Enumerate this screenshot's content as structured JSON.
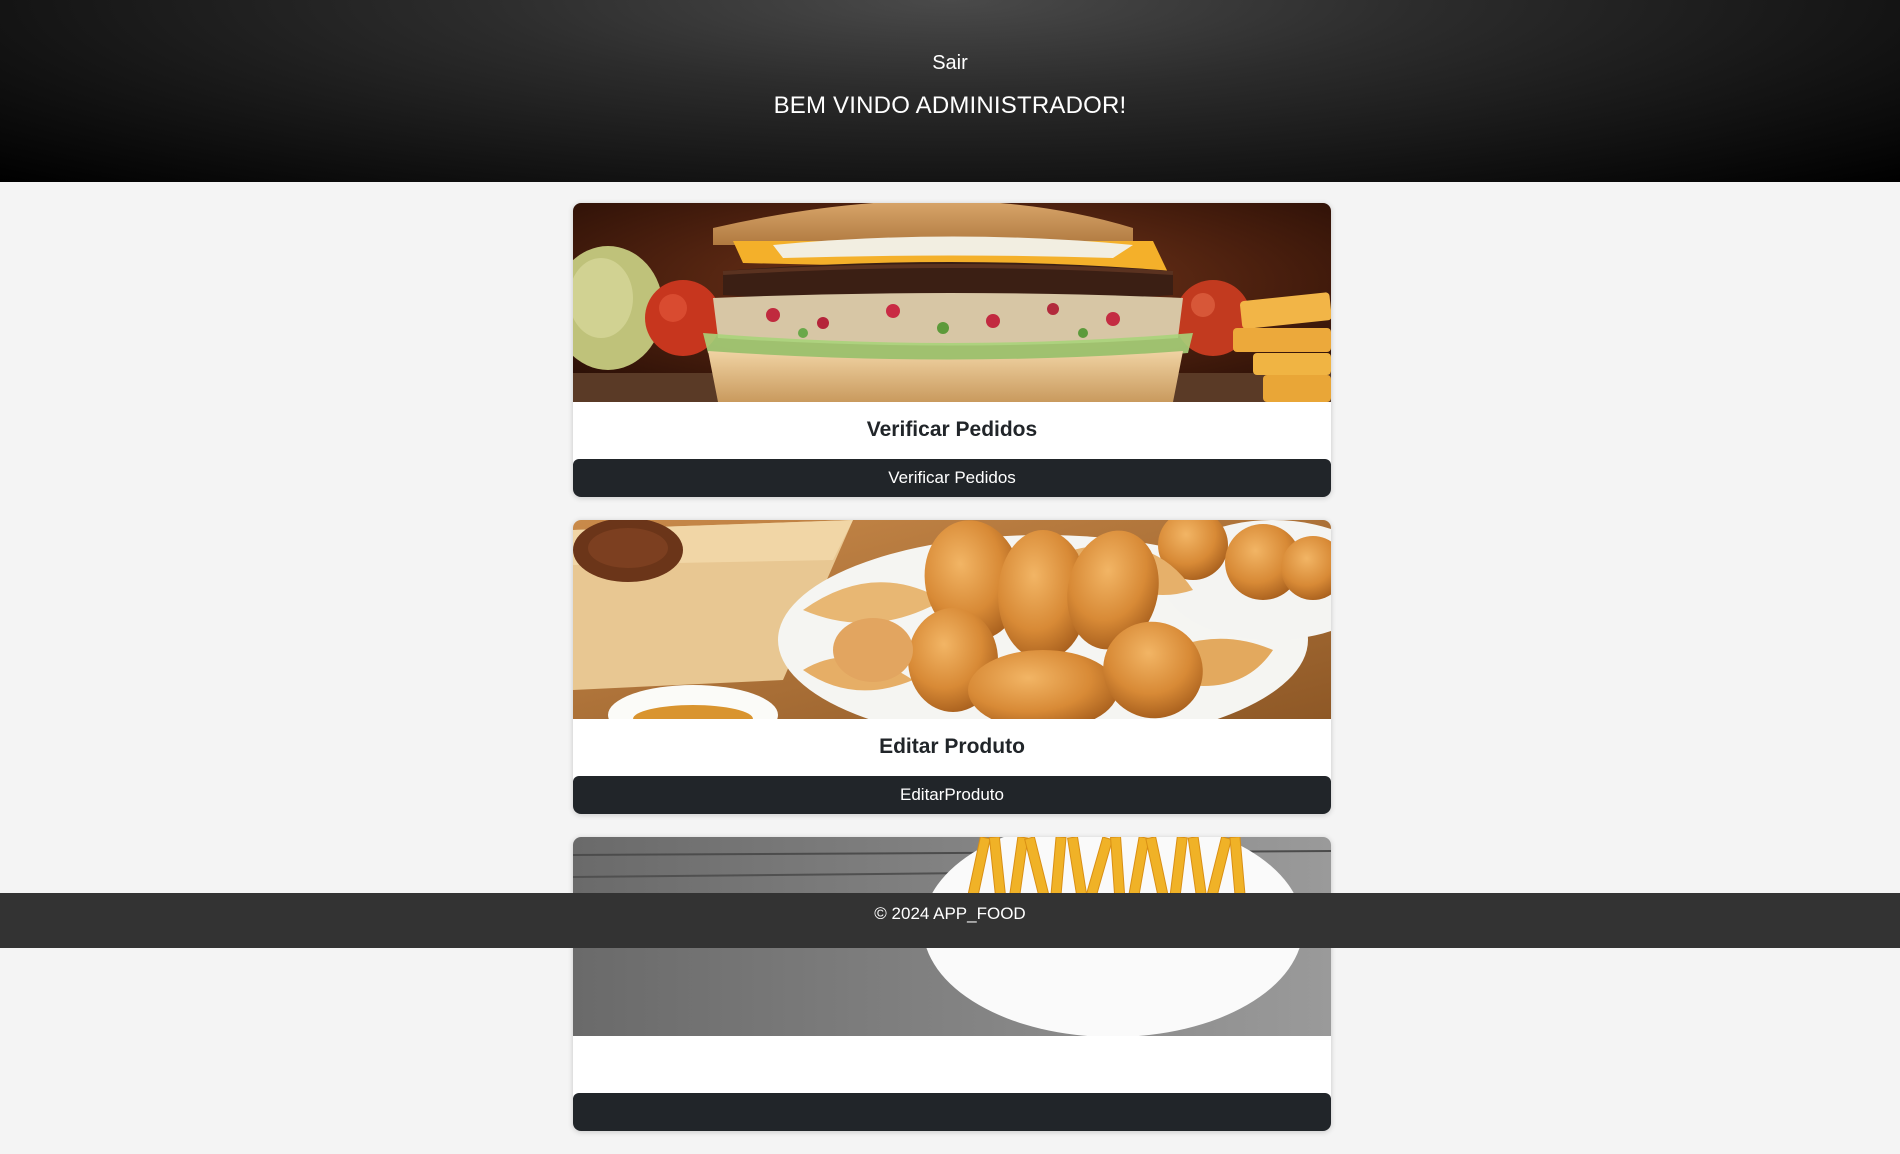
{
  "header": {
    "logout_label": "Sair",
    "welcome_text": "BEM VINDO ADMINISTRADOR!"
  },
  "cards": [
    {
      "image": "burger-image",
      "title": "Verificar Pedidos",
      "button_label": "Verificar Pedidos"
    },
    {
      "image": "savory-snacks-image",
      "title": "Editar Produto",
      "button_label": "EditarProduto"
    },
    {
      "image": "french-fries-image",
      "title": "",
      "button_label": ""
    }
  ],
  "footer": {
    "copyright": "© 2024 APP_FOOD"
  },
  "colors": {
    "header_bg": "#111111",
    "page_bg": "#f4f4f4",
    "button_bg": "#212529",
    "footer_bg": "#333333"
  }
}
